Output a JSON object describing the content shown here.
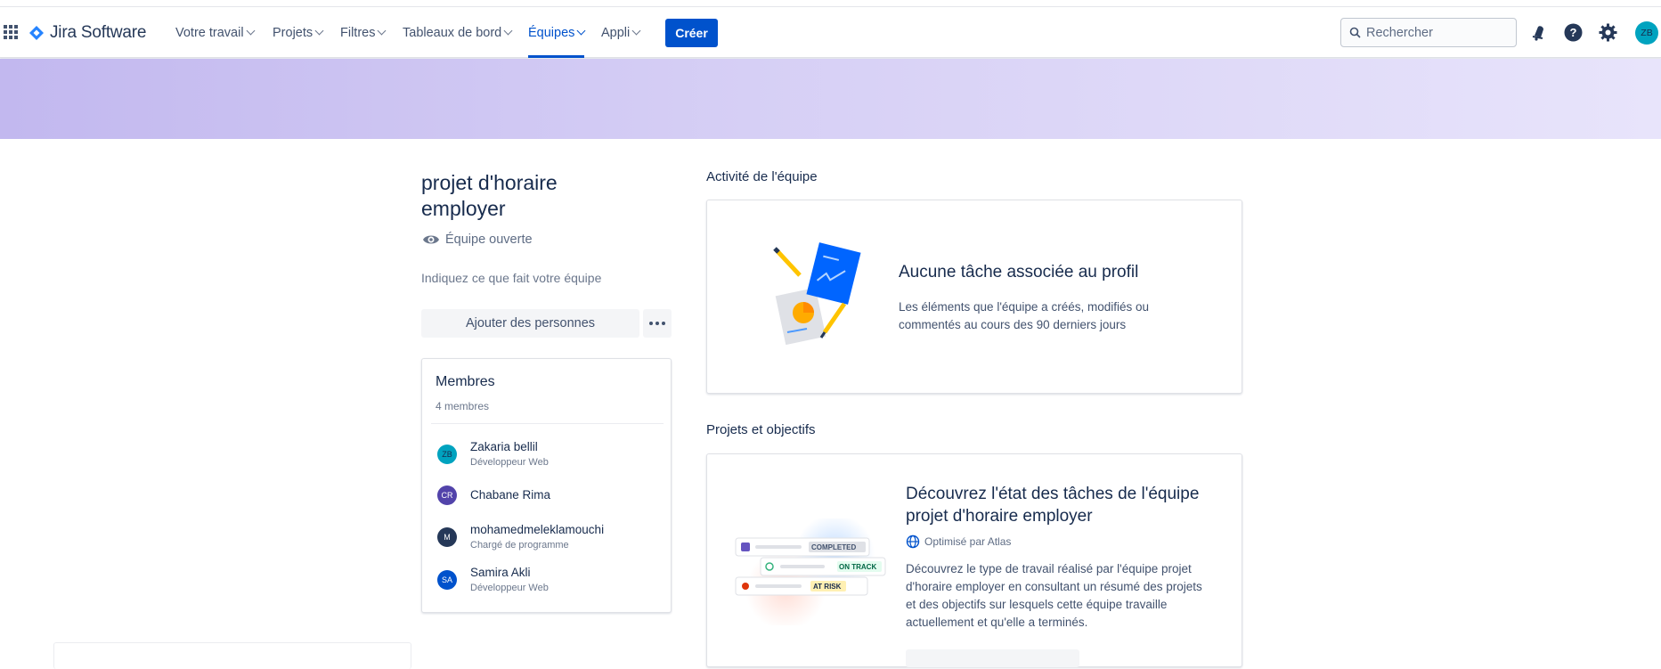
{
  "nav": {
    "app_name": "Jira Software",
    "items": [
      {
        "label": "Votre travail",
        "active": false
      },
      {
        "label": "Projets",
        "active": false
      },
      {
        "label": "Filtres",
        "active": false
      },
      {
        "label": "Tableaux de bord",
        "active": false
      },
      {
        "label": "Équipes",
        "active": true
      },
      {
        "label": "Appli",
        "active": false
      }
    ],
    "create_label": "Créer",
    "search_placeholder": "Rechercher",
    "user_initials": "ZB",
    "accent_color": "#0052cc"
  },
  "team": {
    "name": "projet d'horaire employer",
    "visibility": "Équipe ouverte",
    "description_placeholder": "Indiquez ce que fait votre équipe",
    "add_people_label": "Ajouter des personnes"
  },
  "members": {
    "title": "Membres",
    "count_label": "4 membres",
    "list": [
      {
        "initials": "ZB",
        "name": "Zakaria bellil",
        "role": "Développeur Web",
        "color": "#00a3bf"
      },
      {
        "initials": "CR",
        "name": "Chabane Rima",
        "role": "",
        "color": "#5243aa"
      },
      {
        "initials": "M",
        "name": "mohamedmeleklamouchi",
        "role": "Chargé de programme",
        "color": "#253858"
      },
      {
        "initials": "SA",
        "name": "Samira Akli",
        "role": "Développeur Web",
        "color": "#0052cc"
      }
    ]
  },
  "activity": {
    "section_title": "Activité de l'équipe",
    "empty_title": "Aucune tâche associée au profil",
    "empty_text": "Les éléments que l'équipe a créés, modifiés ou commentés au cours des 90 derniers jours"
  },
  "projects": {
    "section_title": "Projets et objectifs",
    "card_title": "Découvrez l'état des tâches de l'équipe projet d'horaire employer",
    "atlas_label": "Optimisé par Atlas",
    "card_text": "Découvrez le type de travail réalisé par l'équipe projet d'horaire employer en consultant un résumé des projets et des objectifs sur lesquels cette équipe travaille actuellement et qu'elle a terminés.",
    "statuses": [
      {
        "label": "COMPLETED",
        "color": "#dfe1e6"
      },
      {
        "label": "ON TRACK",
        "color": "#e3fcef"
      },
      {
        "label": "AT RISK",
        "color": "#fff0b3"
      }
    ]
  }
}
